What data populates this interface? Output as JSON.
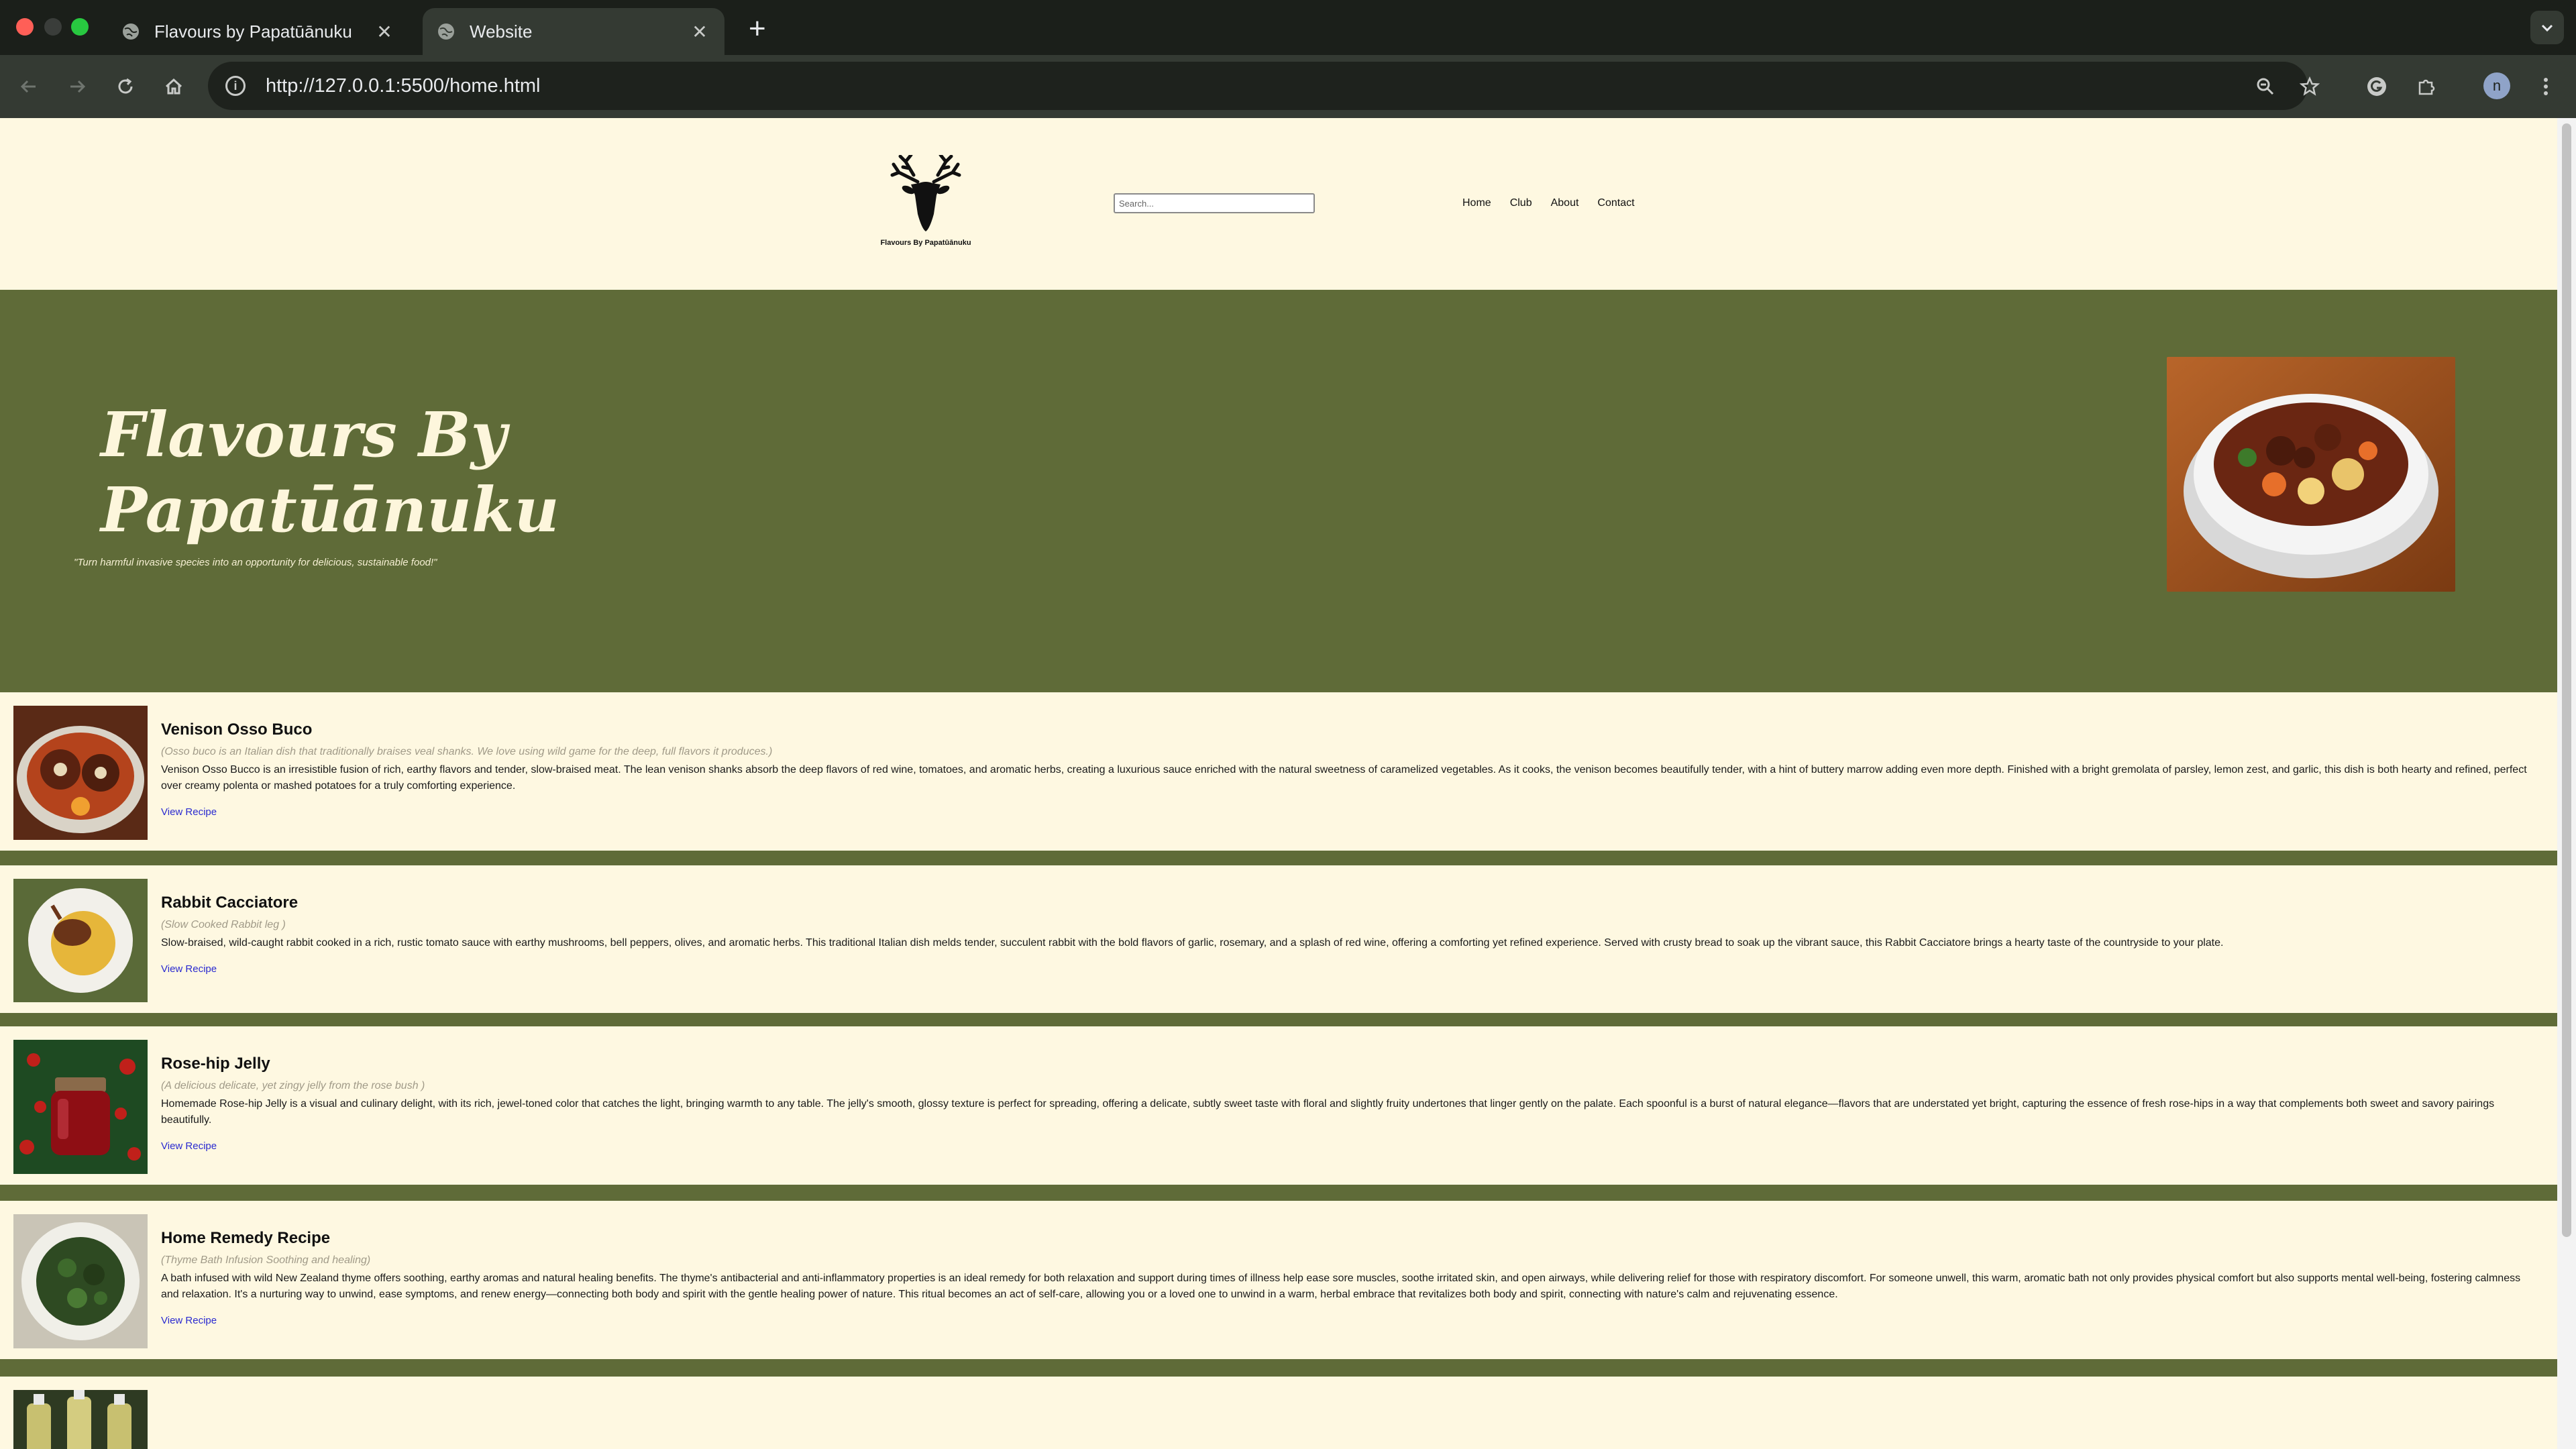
{
  "browser": {
    "tabs": [
      {
        "title": "Flavours by Papatūānuku",
        "active": false
      },
      {
        "title": "Website",
        "active": true
      }
    ],
    "url": "http://127.0.0.1:5500/home.html",
    "profile_initial": "n"
  },
  "header": {
    "logo_text": "Flavours By Papatūānuku",
    "search_placeholder": "Search...",
    "nav": [
      {
        "label": "Home"
      },
      {
        "label": "Club"
      },
      {
        "label": "About"
      },
      {
        "label": "Contact"
      }
    ]
  },
  "hero": {
    "title_line1": "Flavours By",
    "title_line2": "Papatūānuku",
    "tagline": "\"Turn harmful invasive species into an opportunity for delicious, sustainable food!\""
  },
  "recipes": [
    {
      "title": "Venison Osso Buco",
      "subtitle": "(Osso buco is an Italian dish that traditionally braises veal shanks. We love using wild game for the deep, full flavors it produces.)",
      "description": "Venison Osso Bucco is an irresistible fusion of rich, earthy flavors and tender, slow-braised meat. The lean venison shanks absorb the deep flavors of red wine, tomatoes, and aromatic herbs, creating a luxurious sauce enriched with the natural sweetness of caramelized vegetables. As it cooks, the venison becomes beautifully tender, with a hint of buttery marrow adding even more depth. Finished with a bright gremolata of parsley, lemon zest, and garlic, this dish is both hearty and refined, perfect over creamy polenta or mashed potatoes for a truly comforting experience.",
      "link": "View Recipe"
    },
    {
      "title": "Rabbit Cacciatore",
      "subtitle": "(Slow Cooked Rabbit leg )",
      "description": "Slow-braised, wild-caught rabbit cooked in a rich, rustic tomato sauce with earthy mushrooms, bell peppers, olives, and aromatic herbs. This traditional Italian dish melds tender, succulent rabbit with the bold flavors of garlic, rosemary, and a splash of red wine, offering a comforting yet refined experience. Served with crusty bread to soak up the vibrant sauce, this Rabbit Cacciatore brings a hearty taste of the countryside to your plate.",
      "link": "View Recipe"
    },
    {
      "title": "Rose-hip Jelly",
      "subtitle": "(A delicious delicate, yet zingy jelly from the rose bush )",
      "description": "Homemade Rose-hip Jelly is a visual and culinary delight, with its rich, jewel-toned color that catches the light, bringing warmth to any table. The jelly's smooth, glossy texture is perfect for spreading, offering a delicate, subtly sweet taste with floral and slightly fruity undertones that linger gently on the palate. Each spoonful is a burst of natural elegance—flavors that are understated yet bright, capturing the essence of fresh rose-hips in a way that complements both sweet and savory pairings beautifully.",
      "link": "View Recipe"
    },
    {
      "title": "Home Remedy Recipe",
      "subtitle": "(Thyme Bath Infusion Soothing and healing)",
      "description": "A bath infused with wild New Zealand thyme offers soothing, earthy aromas and natural healing benefits. The thyme's antibacterial and anti-inflammatory properties is an ideal remedy for both relaxation and support during times of illness help ease sore muscles, soothe irritated skin, and open airways, while delivering relief for those with respiratory discomfort. For someone unwell, this warm, aromatic bath not only provides physical comfort but also supports mental well-being, fostering calmness and relaxation. It's a nurturing way to unwind, ease symptoms, and renew energy—connecting both body and spirit with the gentle healing power of nature. This ritual becomes an act of self-care, allowing you or a loved one to unwind in a warm, herbal embrace that revitalizes both body and spirit, connecting with nature's calm and rejuvenating essence.",
      "link": "View Recipe"
    }
  ],
  "colors": {
    "cream": "#fef8e1",
    "olive": "#5f6b38",
    "link": "#2a2ad0"
  }
}
